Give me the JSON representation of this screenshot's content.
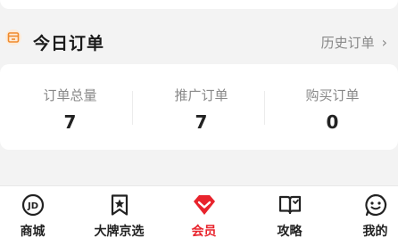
{
  "section": {
    "title": "今日订单",
    "history_label": "历史订单",
    "icon": "shop-icon"
  },
  "stats": [
    {
      "label": "订单总量",
      "value": "7"
    },
    {
      "label": "推广订单",
      "value": "7"
    },
    {
      "label": "购买订单",
      "value": "0"
    }
  ],
  "tabs": [
    {
      "label": "商城",
      "icon": "jd-logo-icon",
      "active": false
    },
    {
      "label": "大牌京选",
      "icon": "bookmark-star-icon",
      "active": false
    },
    {
      "label": "会员",
      "icon": "diamond-icon",
      "active": true
    },
    {
      "label": "攻略",
      "icon": "open-book-icon",
      "active": false
    },
    {
      "label": "我的",
      "icon": "smiley-icon",
      "active": false
    }
  ],
  "colors": {
    "accent": "#e8232c",
    "header_icon": "#f08a2c",
    "text_primary": "#222222",
    "text_secondary": "#888888"
  }
}
